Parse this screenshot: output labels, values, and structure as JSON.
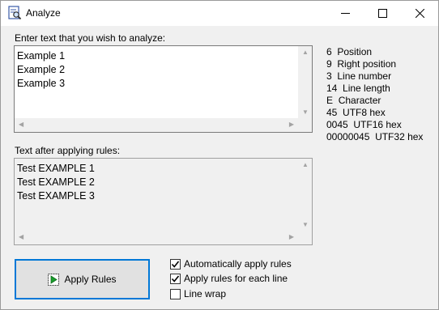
{
  "window": {
    "title": "Analyze",
    "minimize": "—",
    "maximize": "☐",
    "close": "✕"
  },
  "input": {
    "label": "Enter text that you wish to analyze:",
    "lines": [
      "Example 1",
      "Example 2",
      "Example 3"
    ]
  },
  "output": {
    "label": "Text after applying rules:",
    "lines": [
      "Test EXAMPLE 1",
      "Test EXAMPLE 2",
      "Test EXAMPLE 3"
    ]
  },
  "info": [
    {
      "value": "6",
      "label": "Position"
    },
    {
      "value": "9",
      "label": "Right position"
    },
    {
      "value": "3",
      "label": "Line number"
    },
    {
      "value": "14",
      "label": "Line length"
    },
    {
      "value": "E",
      "label": "Character"
    },
    {
      "value": "45",
      "label": "UTF8 hex"
    },
    {
      "value": "0045",
      "label": "UTF16 hex"
    },
    {
      "value": "00000045",
      "label": "UTF32 hex"
    }
  ],
  "apply_button": {
    "label": "Apply Rules"
  },
  "options": [
    {
      "label": "Automatically apply rules",
      "checked": true
    },
    {
      "label": "Apply rules for each line",
      "checked": true
    },
    {
      "label": "Line wrap",
      "checked": false
    }
  ]
}
